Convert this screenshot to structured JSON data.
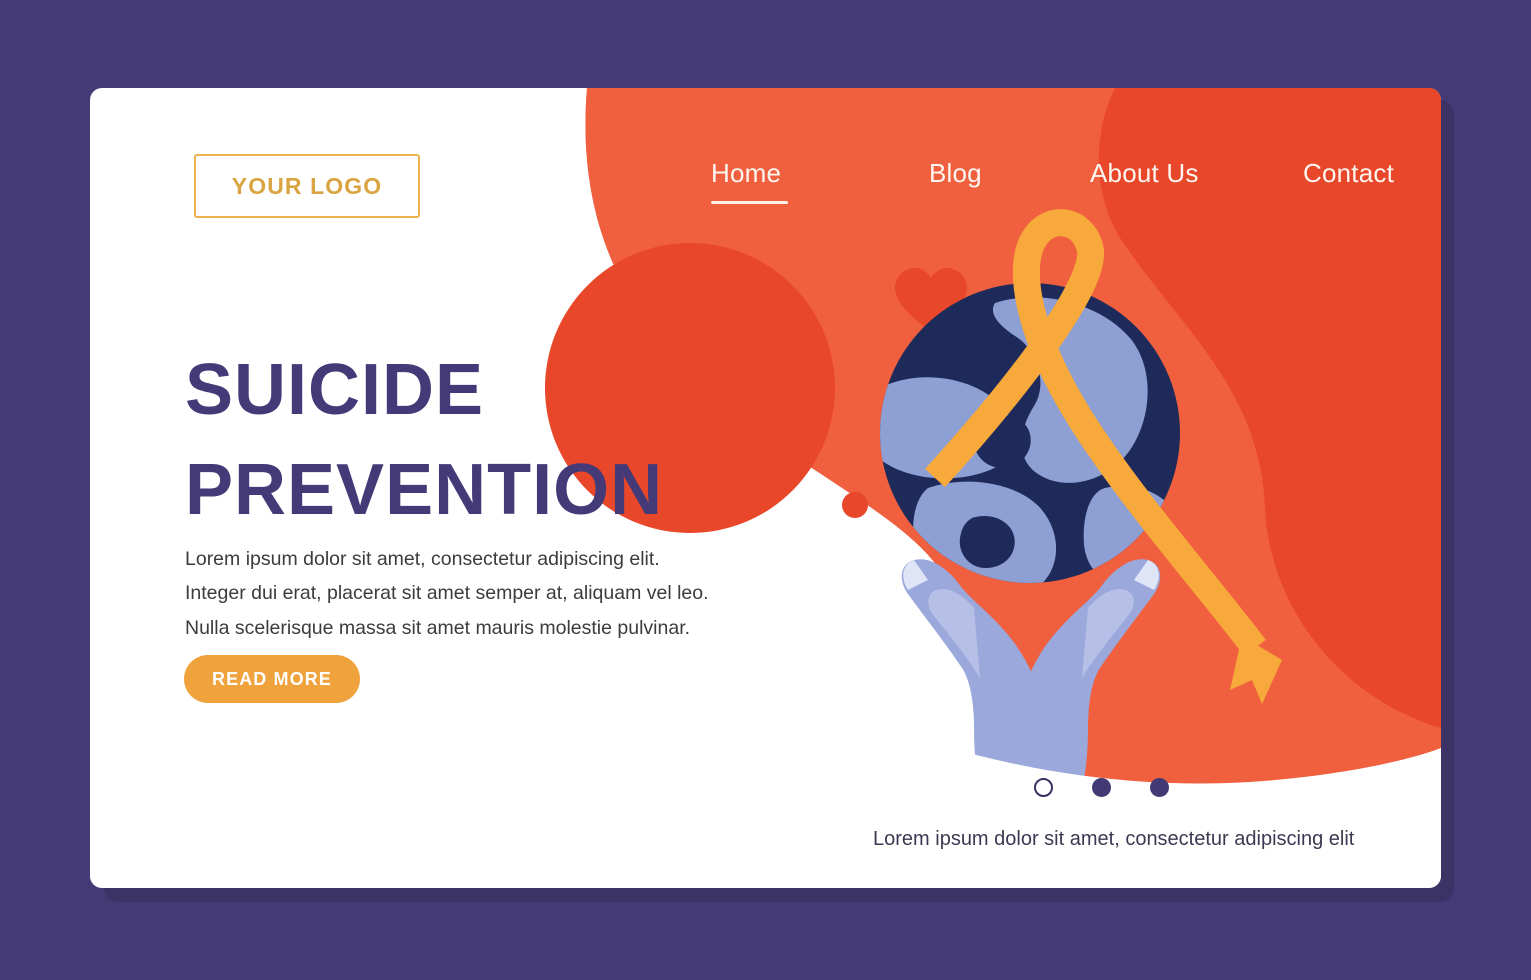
{
  "page": {
    "background_color": "#443a75",
    "card_color": "#ffffff",
    "accent_orange": "#ef5130",
    "accent_orange_light": "#f0603f",
    "accent_amber": "#f7a93b",
    "accent_purple": "#433a75",
    "globe_navy": "#1e2a5a",
    "globe_blue": "#8e9fd4",
    "hand_blue": "#9aa8dc"
  },
  "header": {
    "logo_label": "YOUR LOGO",
    "nav": [
      {
        "label": "Home",
        "active": true
      },
      {
        "label": "Blog",
        "active": false
      },
      {
        "label": "About Us",
        "active": false
      },
      {
        "label": "Contact",
        "active": false
      }
    ]
  },
  "hero": {
    "title_line1": "SUICIDE",
    "title_line2": "PREVENTION",
    "paragraph_line1": "Lorem ipsum dolor sit amet, consectetur adipiscing elit.",
    "paragraph_line2": "Integer dui erat, placerat sit amet semper at, aliquam vel leo.",
    "paragraph_line3": "Nulla scelerisque massa sit amet mauris molestie pulvinar.",
    "cta_label": "READ MORE"
  },
  "carousel": {
    "dots": [
      {
        "state": "outlined"
      },
      {
        "state": "filled"
      },
      {
        "state": "filled"
      }
    ],
    "caption": "Lorem ipsum dolor sit amet, consectetur adipiscing elit"
  },
  "illustration": {
    "name": "hands-holding-globe-with-awareness-ribbon",
    "elements": [
      "globe",
      "left-hand",
      "right-hand",
      "awareness-ribbon",
      "hearts",
      "dots"
    ]
  }
}
